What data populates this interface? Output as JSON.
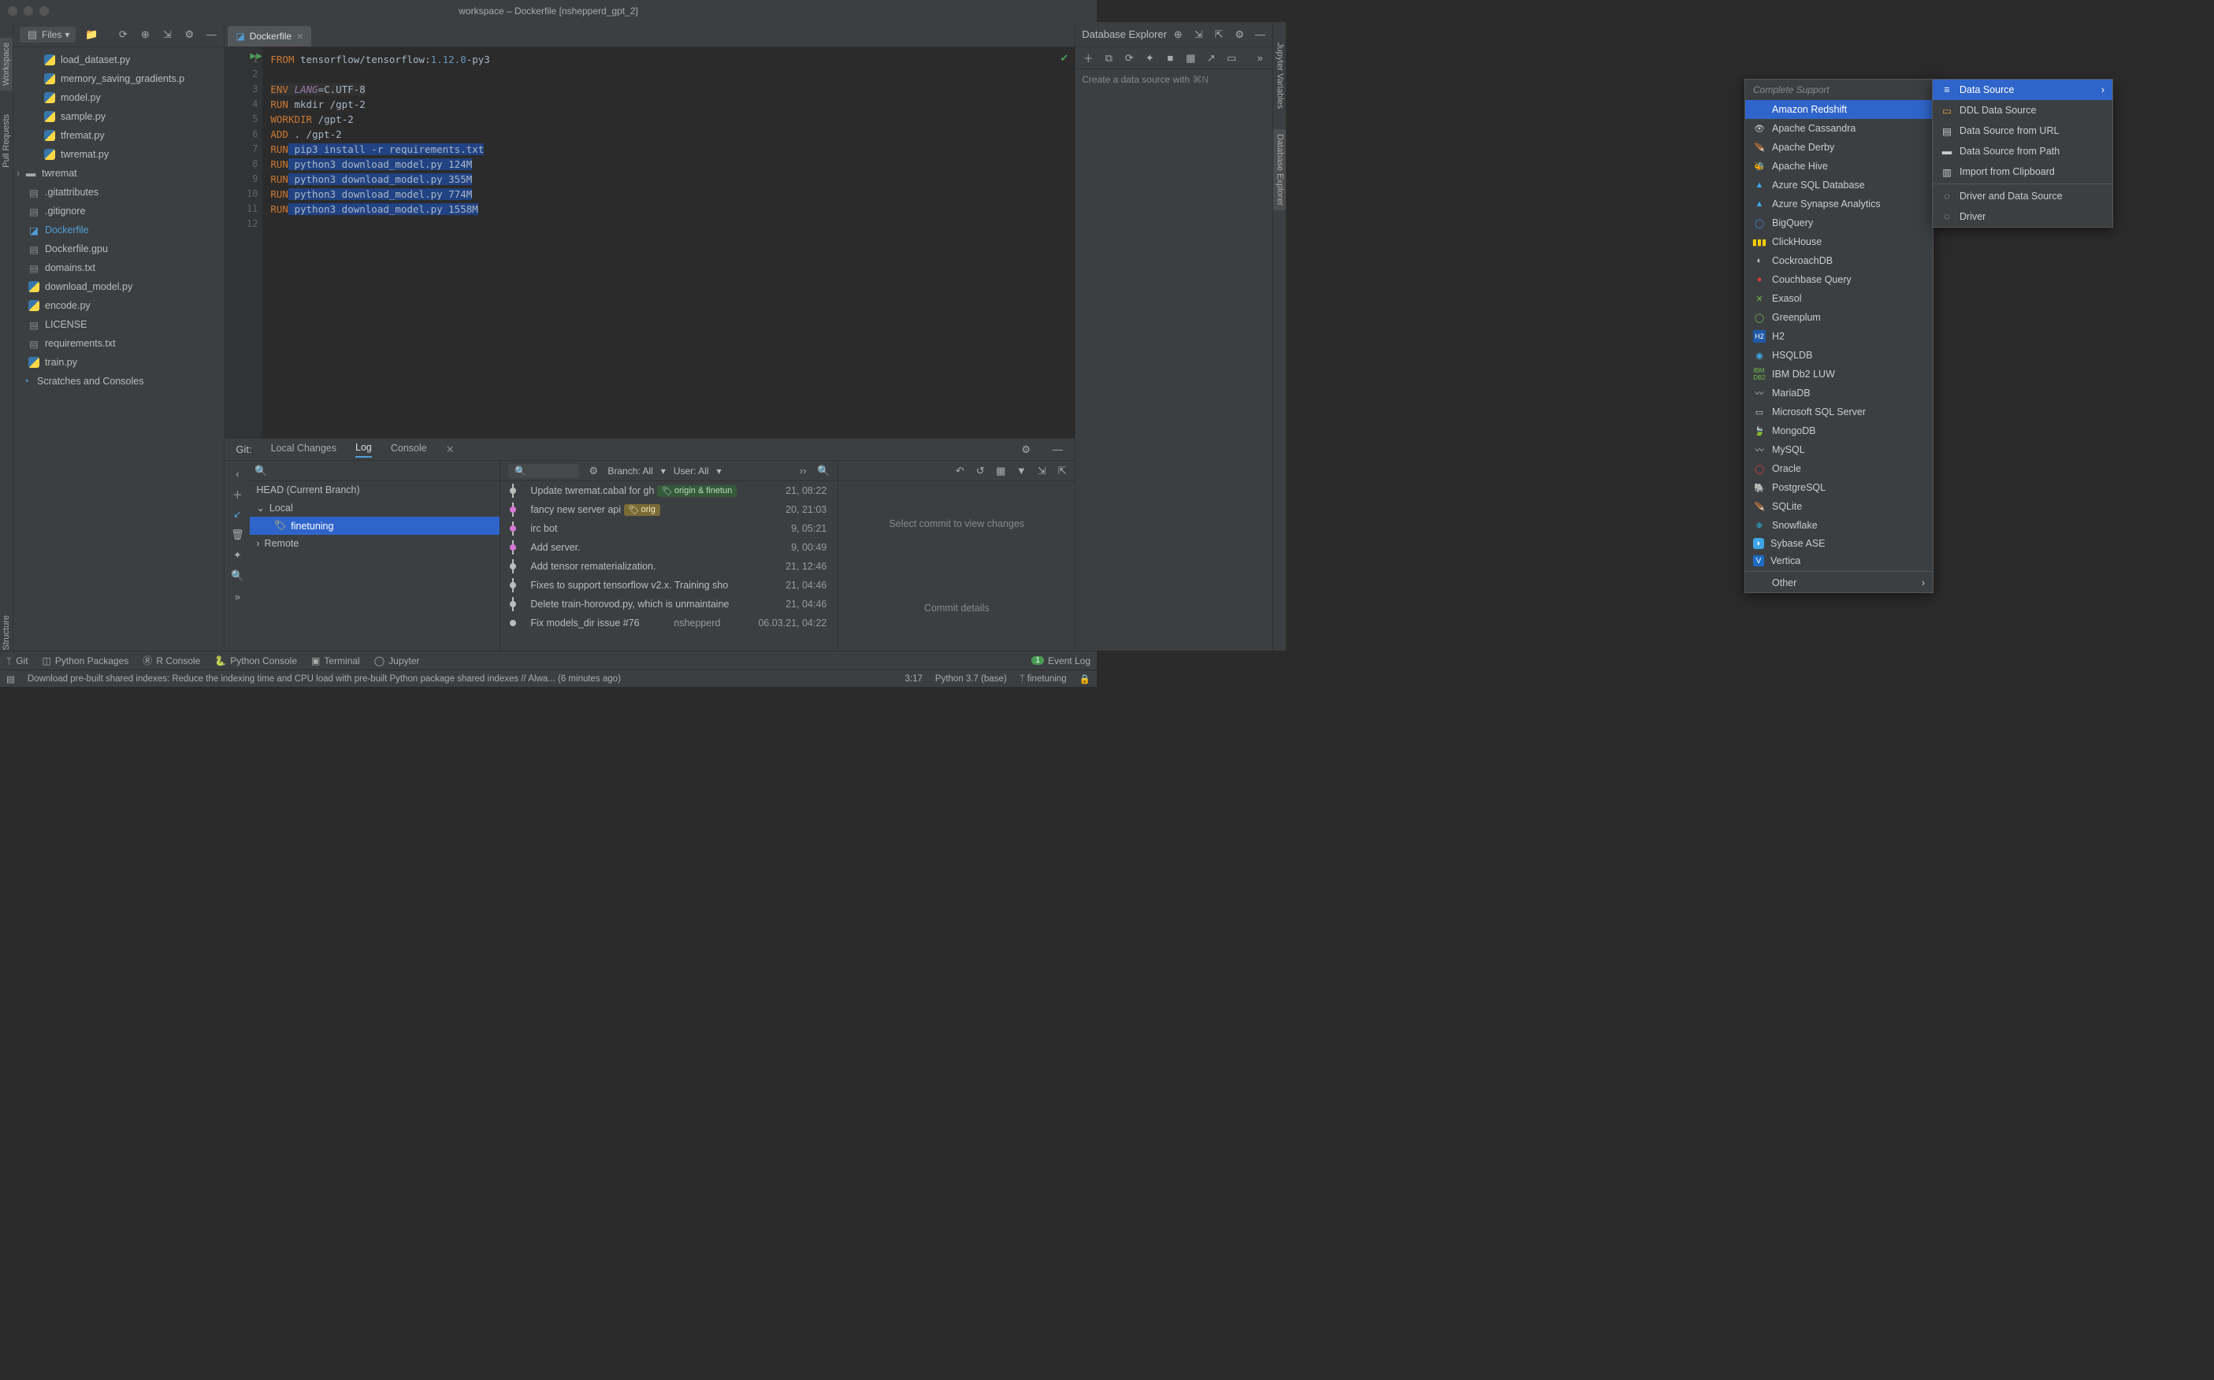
{
  "window_title": "workspace – Dockerfile [nshepperd_gpt_2]",
  "leftstrip": {
    "workspace": "Workspace",
    "pull_requests": "Pull Requests",
    "structure": "Structure"
  },
  "rightstrip": {
    "jupyter": "Jupyter Variables",
    "database": "Database Explorer"
  },
  "files_panel": {
    "label": "Files",
    "tree": [
      {
        "name": "load_dataset.py",
        "icon": "py",
        "indent": 1
      },
      {
        "name": "memory_saving_gradients.p",
        "icon": "py",
        "indent": 1
      },
      {
        "name": "model.py",
        "icon": "py",
        "indent": 1
      },
      {
        "name": "sample.py",
        "icon": "py",
        "indent": 1
      },
      {
        "name": "tfremat.py",
        "icon": "py",
        "indent": 1
      },
      {
        "name": "twremat.py",
        "icon": "py",
        "indent": 1
      },
      {
        "name": "twremat",
        "icon": "folder",
        "indent": 0,
        "chev": true
      },
      {
        "name": ".gitattributes",
        "icon": "file",
        "indent": 0
      },
      {
        "name": ".gitignore",
        "icon": "file",
        "indent": 0
      },
      {
        "name": "Dockerfile",
        "icon": "docker",
        "indent": 0,
        "selected": true
      },
      {
        "name": "Dockerfile.gpu",
        "icon": "file",
        "indent": 0
      },
      {
        "name": "domains.txt",
        "icon": "file",
        "indent": 0
      },
      {
        "name": "download_model.py",
        "icon": "py",
        "indent": 0
      },
      {
        "name": "encode.py",
        "icon": "py",
        "indent": 0
      },
      {
        "name": "LICENSE",
        "icon": "file",
        "indent": 0
      },
      {
        "name": "requirements.txt",
        "icon": "file",
        "indent": 0
      },
      {
        "name": "train.py",
        "icon": "py",
        "indent": 0
      }
    ],
    "scratches": "Scratches and Consoles"
  },
  "tab": {
    "name": "Dockerfile"
  },
  "editor": {
    "lines": [
      "1",
      "2",
      "3",
      "4",
      "5",
      "6",
      "7",
      "8",
      "9",
      "10",
      "11",
      "12"
    ]
  },
  "code": {
    "l1a": "FROM",
    "l1b": " tensorflow/tensorflow:",
    "l1c": "1.12.0",
    "l1d": "-py3",
    "l3a": "ENV ",
    "l3b": "LANG",
    "l3c": "=C.UTF-8",
    "l4a": "RUN",
    "l4b": " mkdir /gpt-2",
    "l5a": "WORKDIR",
    "l5b": " /gpt-2",
    "l6a": "ADD",
    "l6b": " . /gpt-2",
    "l7a": "RUN",
    "l7b": " pip3 install -r requirements.txt",
    "l8a": "RUN",
    "l8b": " python3 download_model.py 124M",
    "l9a": "RUN",
    "l9b": " python3 download_model.py 355M",
    "l10a": "RUN",
    "l10b": " python3 download_model.py 774M",
    "l11a": "RUN",
    "l11b": " python3 download_model.py 1558M"
  },
  "db_panel": {
    "title": "Database Explorer",
    "hint": "Create a data source with"
  },
  "popup_ds": {
    "items": [
      {
        "label": "Data Source",
        "selected": true,
        "chev": true,
        "icon": "db"
      },
      {
        "label": "DDL Data Source",
        "icon": "ddl"
      },
      {
        "label": "Data Source from URL",
        "icon": "url"
      },
      {
        "label": "Data Source from Path",
        "icon": "folder"
      },
      {
        "label": "Import from Clipboard",
        "icon": "clip"
      },
      {
        "sep": true
      },
      {
        "label": "Driver and Data Source",
        "icon": "drv"
      },
      {
        "label": "Driver",
        "icon": "drv"
      }
    ]
  },
  "popup_db": {
    "header": "Complete Support",
    "items": [
      {
        "label": "Amazon Redshift",
        "selected": true
      },
      {
        "label": "Apache Cassandra"
      },
      {
        "label": "Apache Derby"
      },
      {
        "label": "Apache Hive"
      },
      {
        "label": "Azure SQL Database"
      },
      {
        "label": "Azure Synapse Analytics"
      },
      {
        "label": "BigQuery"
      },
      {
        "label": "ClickHouse"
      },
      {
        "label": "CockroachDB"
      },
      {
        "label": "Couchbase Query"
      },
      {
        "label": "Exasol"
      },
      {
        "label": "Greenplum"
      },
      {
        "label": "H2"
      },
      {
        "label": "HSQLDB"
      },
      {
        "label": "IBM Db2 LUW"
      },
      {
        "label": "MariaDB"
      },
      {
        "label": "Microsoft SQL Server"
      },
      {
        "label": "MongoDB"
      },
      {
        "label": "MySQL"
      },
      {
        "label": "Oracle"
      },
      {
        "label": "PostgreSQL"
      },
      {
        "label": "SQLite"
      },
      {
        "label": "Snowflake"
      },
      {
        "label": "Sybase ASE"
      },
      {
        "label": "Vertica"
      }
    ],
    "other": "Other"
  },
  "git": {
    "title": "Git:",
    "tabs": {
      "local": "Local Changes",
      "log": "Log",
      "console": "Console"
    },
    "branches": {
      "head": "HEAD (Current Branch)",
      "local": "Local",
      "finetuning": "finetuning",
      "remote": "Remote"
    },
    "filters": {
      "branch": "Branch: All",
      "user": "User: All"
    },
    "log": [
      {
        "msg": "Update twremat.cabal for gh",
        "tags": [
          "origin & finetun"
        ],
        "tagclass": "g",
        "auth": "",
        "date": "21, 08:22"
      },
      {
        "msg": "fancy new server api",
        "tags": [
          "orig"
        ],
        "tagclass": "y",
        "auth": "",
        "date": "20, 21:03"
      },
      {
        "msg": "irc bot",
        "auth": "",
        "date": "9, 05:21"
      },
      {
        "msg": "Add server.",
        "auth": "",
        "date": "9, 00:49"
      },
      {
        "msg": "Add tensor rematerialization.",
        "auth": "",
        "date": "21, 12:46"
      },
      {
        "msg": "Fixes to support tensorflow v2.x. Training sho",
        "auth": "",
        "date": "21, 04:46"
      },
      {
        "msg": "Delete train-horovod.py, which is unmaintaine",
        "auth": "",
        "date": "21, 04:46"
      },
      {
        "msg": "Fix models_dir issue #76",
        "auth": "nshepperd",
        "date": "06.03.21, 04:22"
      }
    ],
    "right": {
      "placeholder": "Select commit to view changes",
      "details": "Commit details"
    }
  },
  "bottombar": {
    "git": "Git",
    "pypkg": "Python Packages",
    "rconsole": "R Console",
    "pyconsole": "Python Console",
    "terminal": "Terminal",
    "jupyter": "Jupyter",
    "eventlog": "Event Log"
  },
  "statusbar": {
    "msg": "Download pre-built shared indexes: Reduce the indexing time and CPU load with pre-built Python package shared indexes // Alwa... (6 minutes ago)",
    "pos": "3:17",
    "py": "Python 3.7 (base)",
    "branch": "finetuning"
  }
}
